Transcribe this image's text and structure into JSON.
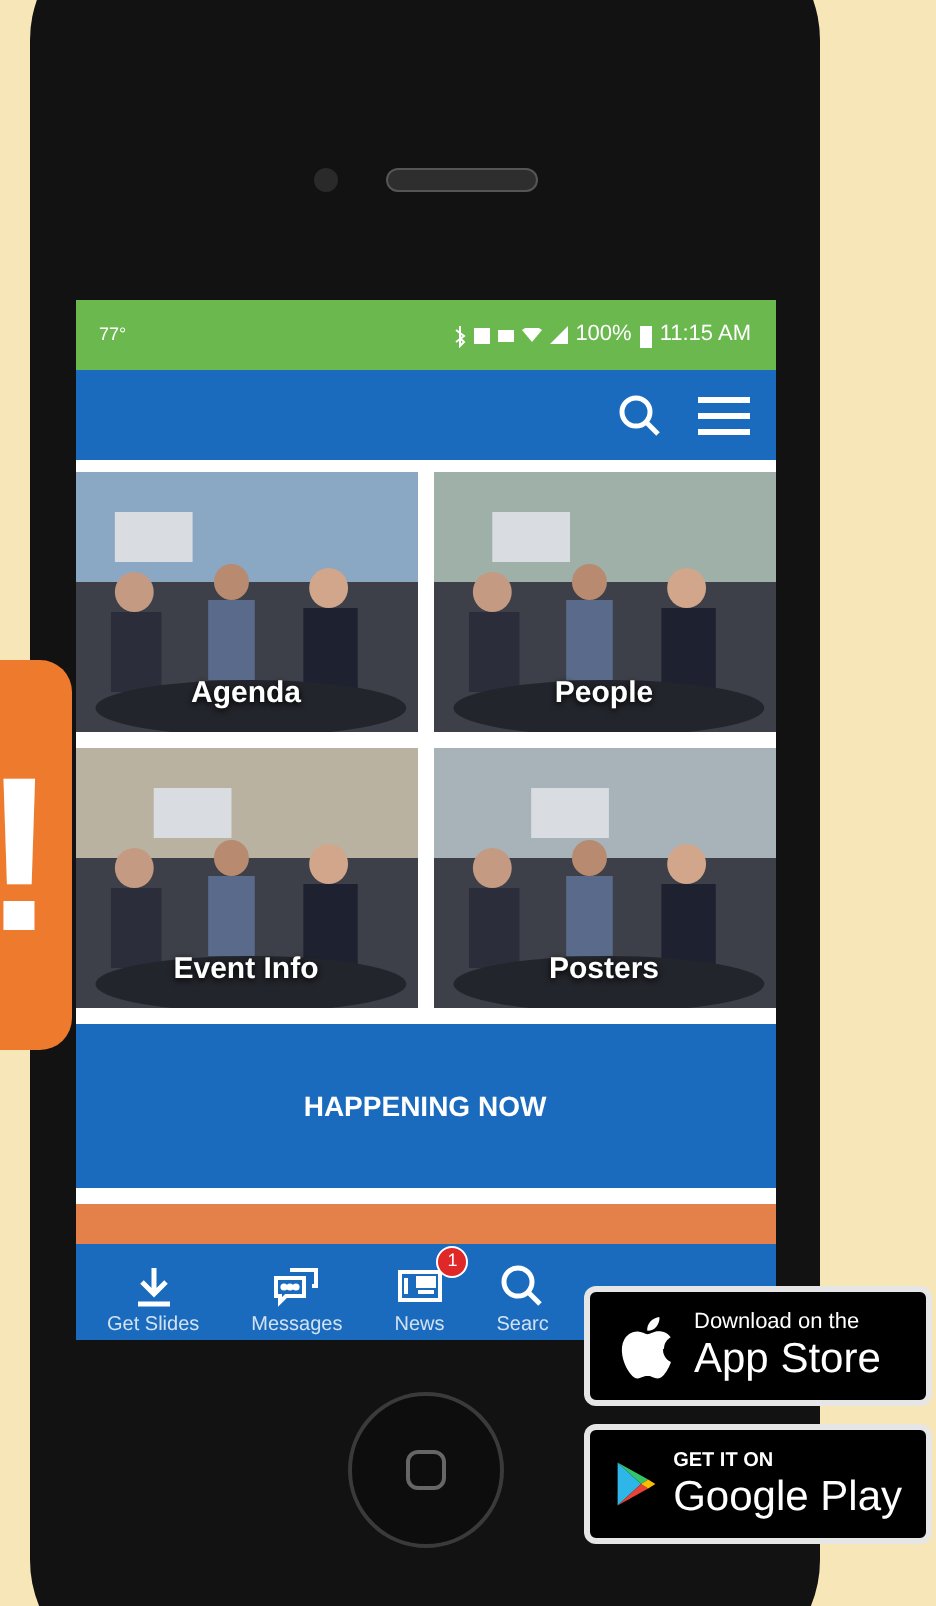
{
  "promo_card": {
    "text": "!"
  },
  "status_bar": {
    "temperature": "77°",
    "battery": "100%",
    "time": "11:15 AM"
  },
  "tiles": [
    {
      "label": "Agenda"
    },
    {
      "label": "People"
    },
    {
      "label": "Event Info"
    },
    {
      "label": "Posters"
    }
  ],
  "banner": {
    "label": "HAPPENING NOW"
  },
  "bottom_nav": [
    {
      "label": "Get Slides",
      "kind": "download"
    },
    {
      "label": "Messages",
      "kind": "messages"
    },
    {
      "label": "News",
      "kind": "news",
      "badge": "1"
    },
    {
      "label": "Searc",
      "kind": "search"
    }
  ],
  "store_badges": [
    {
      "kind": "apple",
      "small": "Download on the",
      "big": "App Store"
    },
    {
      "kind": "google",
      "small": "GET IT ON",
      "big": "Google Play"
    }
  ]
}
